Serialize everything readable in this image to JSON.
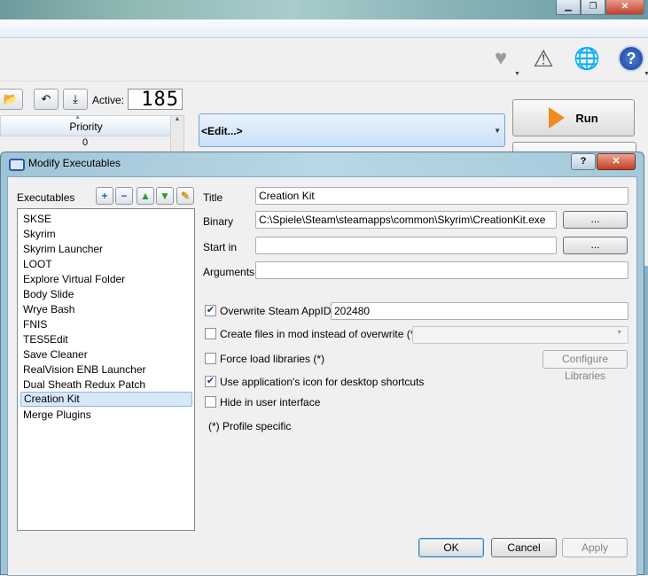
{
  "main_window": {
    "active_label": "Active:",
    "active_count": "185",
    "priority_header": "Priority",
    "priority_value": "0",
    "edit_combo": "<Edit...>",
    "run_button": "Run",
    "toolbar_icons": [
      "heart-icon",
      "warning-icon",
      "globe-icon",
      "help-icon"
    ]
  },
  "dialog": {
    "title": "Modify Executables",
    "help_btn": "?",
    "close_btn": "✕",
    "executables_label": "Executables",
    "executables": [
      "SKSE",
      "Skyrim",
      "Skyrim Launcher",
      "LOOT",
      "Explore Virtual Folder",
      "Body Slide",
      "Wrye Bash",
      "FNIS",
      "TES5Edit",
      "Save Cleaner",
      "RealVision ENB Launcher",
      "Dual Sheath Redux Patch",
      "Creation Kit",
      "Merge Plugins"
    ],
    "selected_executable": "Creation Kit",
    "fields": {
      "title_label": "Title",
      "title_value": "Creation Kit",
      "binary_label": "Binary",
      "binary_value": "C:\\Spiele\\Steam\\steamapps\\common\\Skyrim\\CreationKit.exe",
      "start_in_label": "Start in",
      "start_in_value": "",
      "arguments_label": "Arguments",
      "arguments_value": "",
      "browse_label": "..."
    },
    "options": {
      "overwrite_appid_label": "Overwrite Steam AppID",
      "overwrite_appid_checked": true,
      "appid_value": "202480",
      "create_files_label": "Create files in mod instead of overwrite (*)",
      "create_files_checked": false,
      "force_load_label": "Force load libraries (*)",
      "force_load_checked": false,
      "configure_libraries_label": "Configure Libraries",
      "use_app_icon_label": "Use application's icon for desktop shortcuts",
      "use_app_icon_checked": true,
      "hide_ui_label": "Hide in user interface",
      "hide_ui_checked": false
    },
    "profile_specific_note": "(*) Profile specific",
    "buttons": {
      "ok": "OK",
      "cancel": "Cancel",
      "apply": "Apply"
    }
  }
}
